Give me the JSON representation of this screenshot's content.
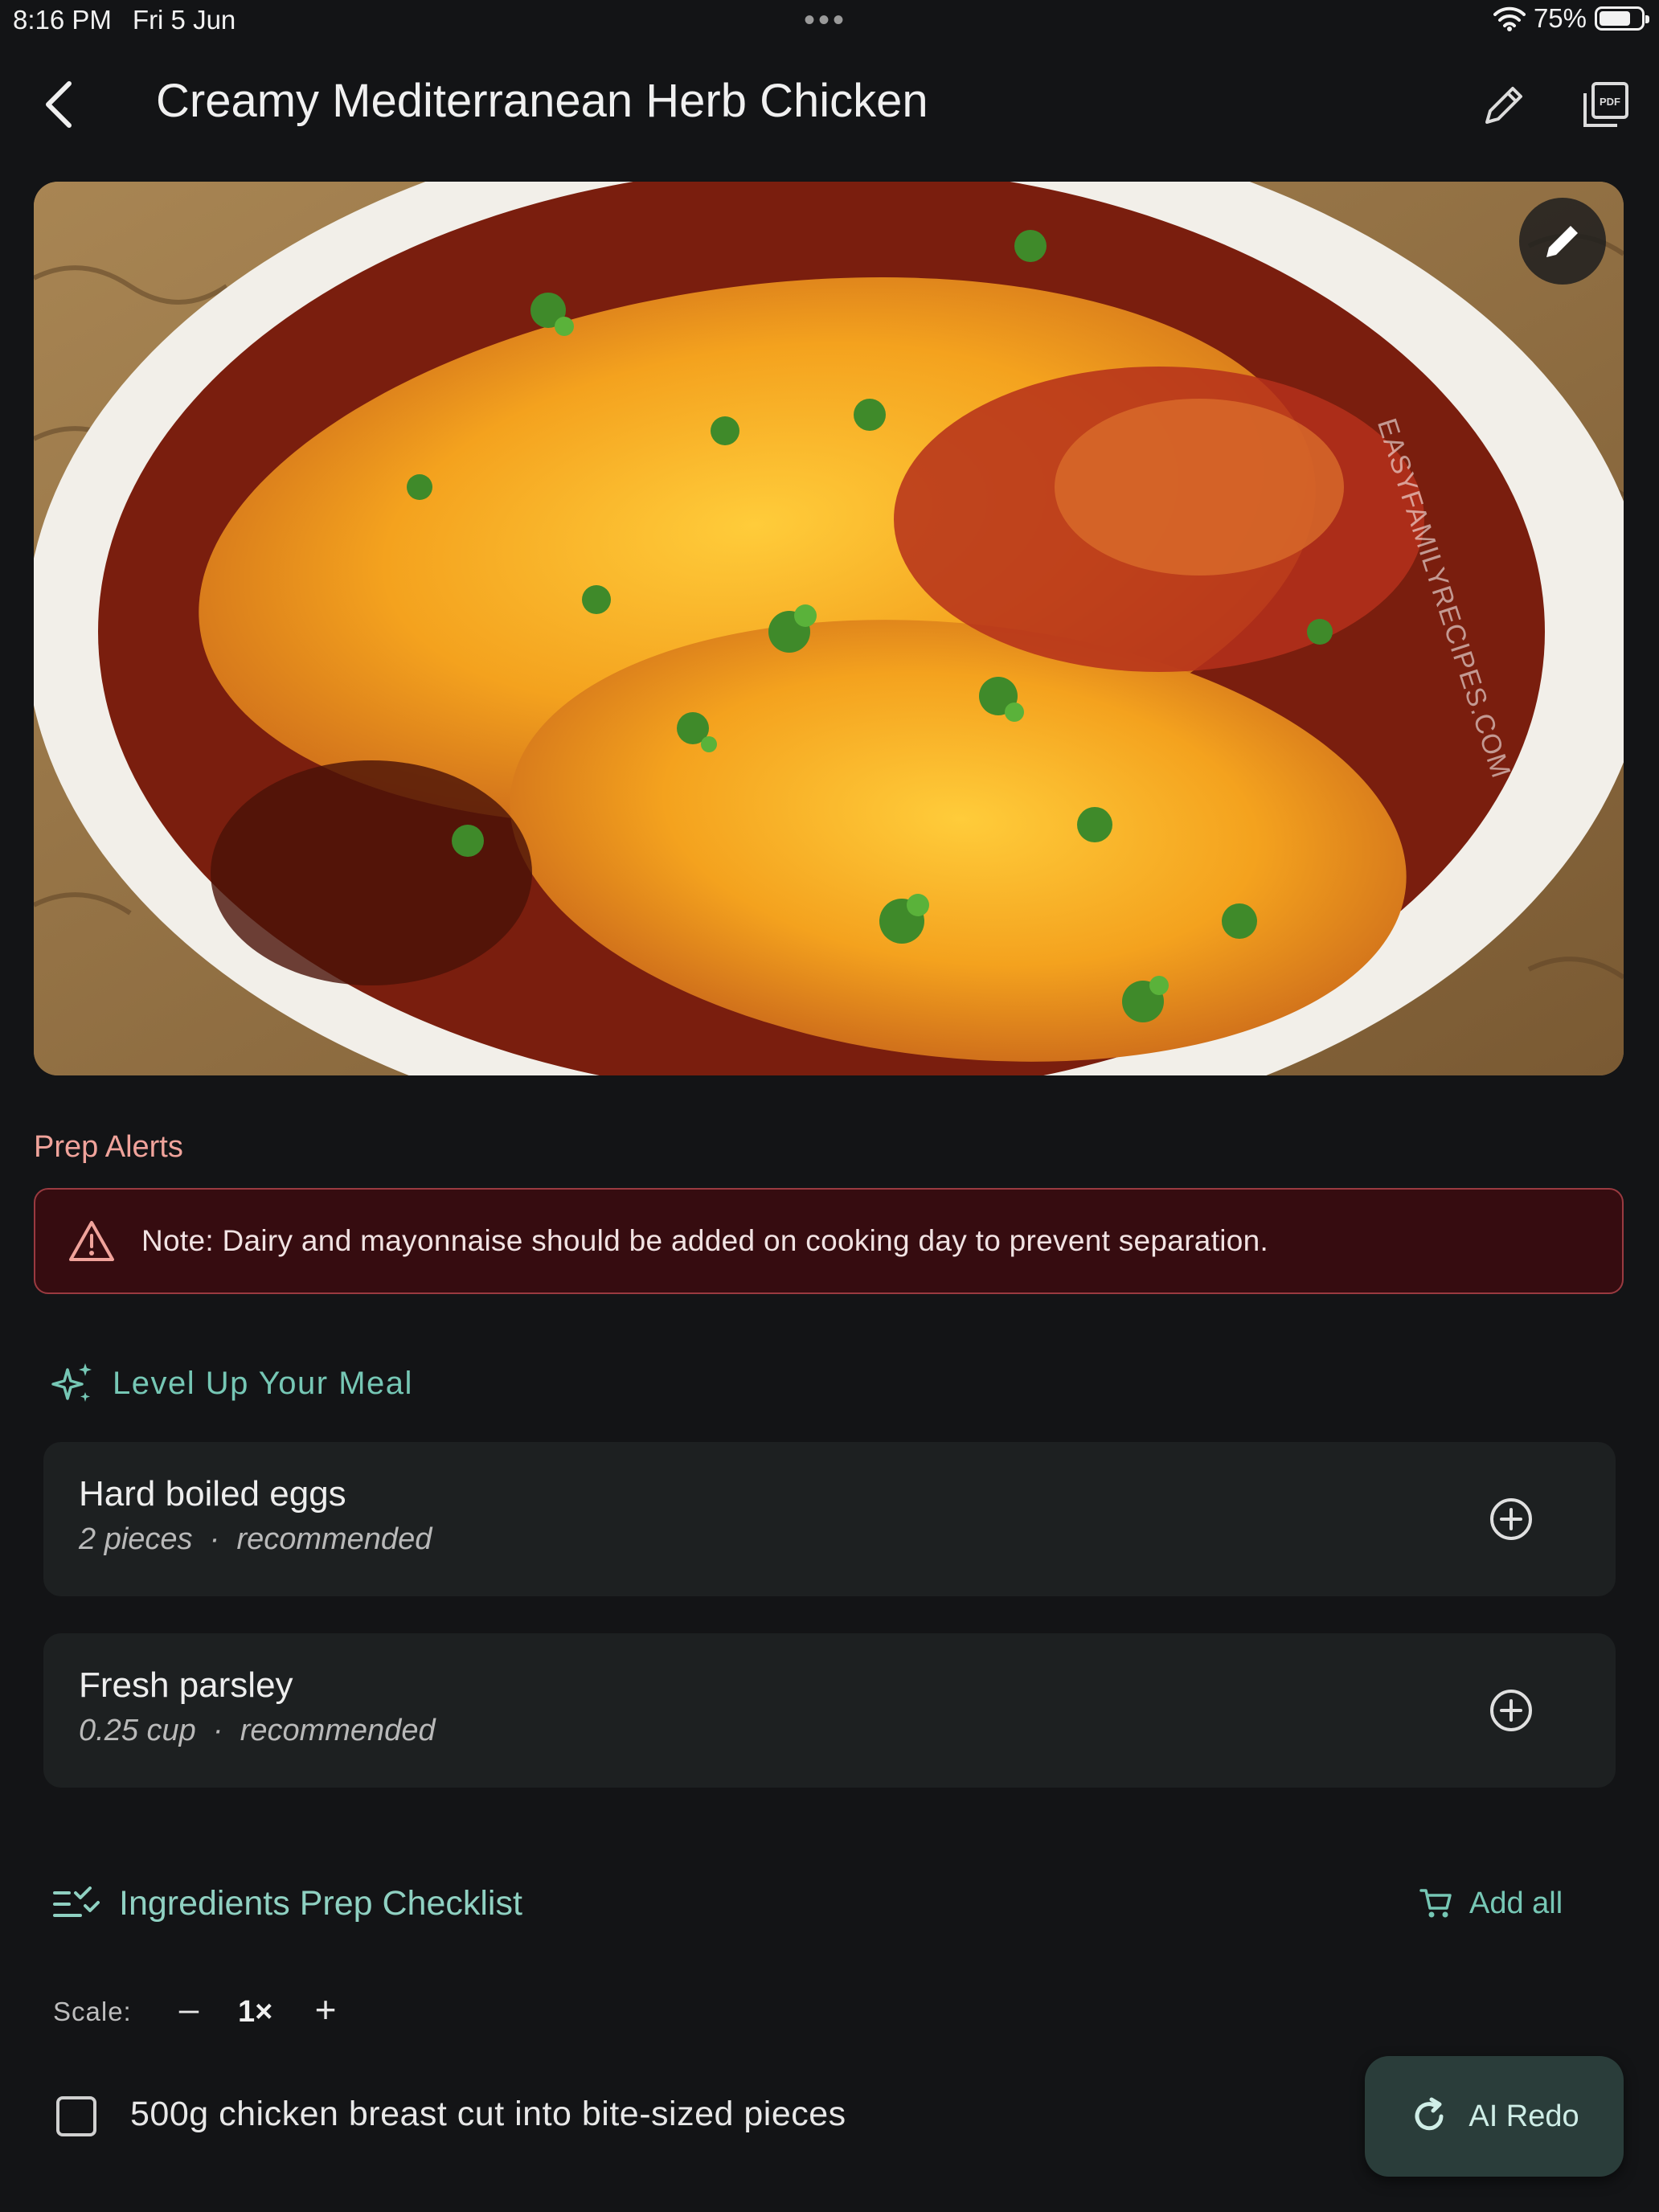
{
  "status_bar": {
    "time": "8:16 PM",
    "date": "Fri 5 Jun",
    "dots": "•••",
    "battery": "75%",
    "battery_level": 0.75
  },
  "header": {
    "title": "Creamy Mediterranean Herb Chicken",
    "icons": [
      "back-arrow-icon",
      "pencil-icon",
      "pdf-icon"
    ]
  },
  "hero": {
    "watermark": "EASYFAMILYRECIPES.COM",
    "edit_icon": "pencil-icon"
  },
  "prep_alerts": {
    "heading": "Prep Alerts",
    "note": "Note: Dairy and mayonnaise should be added on cooking day to prevent separation.",
    "icon": "warning-triangle-icon",
    "accent": "#f0a39b"
  },
  "level_up": {
    "heading": "Level Up Your Meal",
    "icon": "sparkle-icon",
    "items": [
      {
        "name": "Hard boiled eggs",
        "amount": "2 pieces",
        "tag": "recommended"
      },
      {
        "name": "Fresh parsley",
        "amount": "0.25 cup",
        "tag": "recommended"
      }
    ],
    "accent": "#76c7b5"
  },
  "checklist": {
    "heading": "Ingredients Prep Checklist",
    "add_all": "Add all",
    "scale_label": "Scale:",
    "scale_minus": "–",
    "scale_value": "1×",
    "scale_plus": "+",
    "ingredients": [
      "500g chicken breast cut into bite-sized pieces"
    ]
  },
  "fab": {
    "label": "AI Redo",
    "icon": "refresh-icon"
  }
}
